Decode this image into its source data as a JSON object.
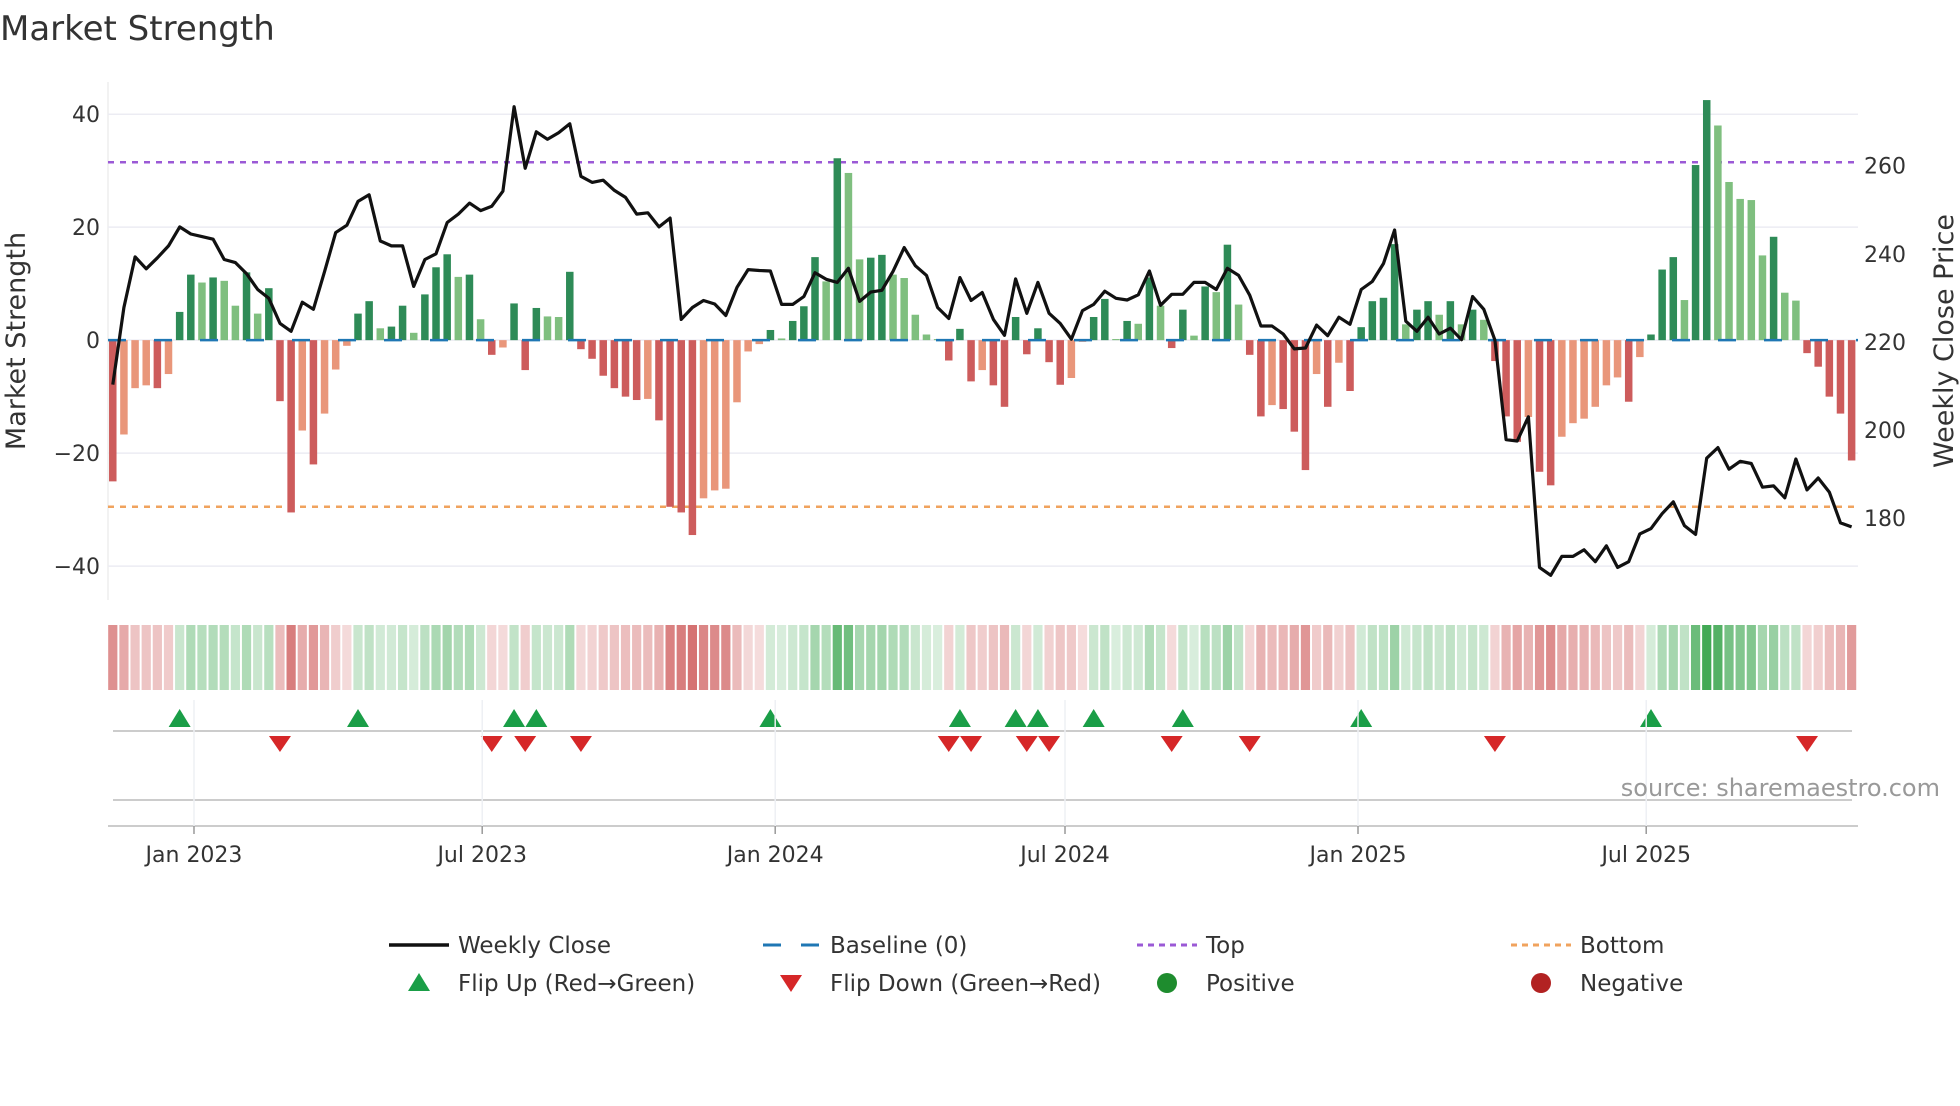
{
  "title": "Market Strength",
  "source": "source: sharemaestro.com",
  "colors": {
    "pos_strong": "#2e8b57",
    "pos_weak": "#7fbf7f",
    "neg_strong": "#cd5c5c",
    "neg_weak": "#e9967a",
    "price": "#111111",
    "baseline": "#1f77b4",
    "top": "#9b59d6",
    "bottom": "#f0a35e",
    "flip_up": "#1a9e47",
    "flip_down": "#d62728",
    "positive": "#1e8c2e",
    "negative": "#b22222"
  },
  "legend": [
    {
      "key": "price",
      "label": "Weekly Close",
      "icon": "line-solid"
    },
    {
      "key": "baseline",
      "label": "Baseline (0)",
      "icon": "line-dashed"
    },
    {
      "key": "top",
      "label": "Top",
      "icon": "line-dotted"
    },
    {
      "key": "bottom",
      "label": "Bottom",
      "icon": "line-dotted"
    },
    {
      "key": "flip_up",
      "label": "Flip Up (Red→Green)",
      "icon": "triangle-up"
    },
    {
      "key": "flip_down",
      "label": "Flip Down (Green→Red)",
      "icon": "triangle-down"
    },
    {
      "key": "positive",
      "label": "Positive",
      "icon": "circle"
    },
    {
      "key": "negative",
      "label": "Negative",
      "icon": "circle"
    }
  ],
  "chart_data": {
    "type": "bar+line",
    "title": "Market Strength",
    "ylabel": "Market Strength",
    "y2label": "Weekly Close Price",
    "x_start": "2022-11-11",
    "x_interval_days": 7,
    "xlim": [
      "2022-11-08",
      "2025-11-11"
    ],
    "xticks": [
      {
        "date": "2023-01-01",
        "label": "Jan 2023"
      },
      {
        "date": "2023-07-01",
        "label": "Jul 2023"
      },
      {
        "date": "2024-01-01",
        "label": "Jan 2024"
      },
      {
        "date": "2024-07-01",
        "label": "Jul 2024"
      },
      {
        "date": "2025-01-01",
        "label": "Jan 2025"
      },
      {
        "date": "2025-07-01",
        "label": "Jul 2025"
      }
    ],
    "ylim": [
      -46,
      45.7
    ],
    "yticks": [
      40,
      20,
      0,
      -20,
      -40
    ],
    "ytick_labels": [
      "40",
      "20",
      "0",
      "−20",
      "−40"
    ],
    "y2lim": [
      161.4,
      279
    ],
    "y2ticks": [
      260,
      240,
      220,
      200,
      180
    ],
    "y2tick_labels": [
      "260",
      "240",
      "220",
      "200",
      "180"
    ],
    "top_level": 31.5,
    "bottom_level": -29.5,
    "baseline": 0,
    "grid": true,
    "legend_position": "bottom",
    "strength": [
      -25,
      -16.7,
      -8.5,
      -8,
      -8.5,
      -6,
      5,
      11.6,
      10.2,
      11.1,
      10.5,
      6.1,
      12,
      4.7,
      9.2,
      -10.8,
      -30.5,
      -16,
      -22,
      -13,
      -5.2,
      -1,
      4.7,
      6.9,
      2.1,
      2.4,
      6.1,
      1.3,
      8.1,
      12.9,
      15.2,
      11.2,
      11.6,
      3.7,
      -2.6,
      -1.3,
      6.5,
      -5.3,
      5.7,
      4.2,
      4.1,
      12.1,
      -1.6,
      -3.3,
      -6.3,
      -8.5,
      -10,
      -10.6,
      -10.4,
      -14.2,
      -29.5,
      -30.5,
      -34.5,
      -28,
      -26.6,
      -26.3,
      -11,
      -2,
      -0.7,
      1.8,
      0.3,
      3.4,
      6,
      14.7,
      10.4,
      32.2,
      29.6,
      14.3,
      14.6,
      15.1,
      11.6,
      11,
      4.5,
      1,
      0.2,
      -3.6,
      2,
      -7.3,
      -5.3,
      -8,
      -11.8,
      4.1,
      -2.5,
      2.1,
      -3.9,
      -7.9,
      -6.7,
      -0.3,
      4.1,
      7.3,
      0.2,
      3.4,
      2.9,
      11.1,
      6.1,
      -1.4,
      5.4,
      0.8,
      9.5,
      8.5,
      16.9,
      6.3,
      -2.6,
      -13.5,
      -11.5,
      -12.2,
      -16.2,
      -23,
      -6,
      -11.8,
      -4,
      -9,
      2.3,
      6.9,
      7.5,
      17,
      2.8,
      5.4,
      6.9,
      4.5,
      6.9,
      2.8,
      5.4,
      3.6,
      -3.7,
      -13.5,
      -18,
      -13.6,
      -23.3,
      -25.7,
      -17.1,
      -14.7,
      -13.9,
      -11.8,
      -8,
      -6.6,
      -10.9,
      -3,
      1,
      12.5,
      14.7,
      7.1,
      31,
      42.5,
      38,
      28,
      25,
      24.8,
      15,
      18.3,
      8.4,
      7,
      -2.3,
      -4.7,
      -10,
      -13,
      -21.3
    ],
    "weekly_close": [
      210.3,
      227.8,
      239.3,
      236.6,
      239.1,
      241.8,
      246.1,
      244.5,
      243.9,
      243.3,
      238.7,
      238.0,
      235.5,
      231.9,
      229.9,
      224.2,
      222.4,
      229.0,
      227.4,
      236.0,
      244.8,
      246.5,
      251.9,
      253.4,
      242.9,
      241.8,
      241.8,
      232.6,
      238.7,
      240.0,
      247.1,
      249.0,
      251.5,
      249.8,
      250.8,
      254.2,
      273.4,
      259.4,
      267.7,
      266.0,
      267.5,
      269.5,
      257.6,
      256.2,
      256.7,
      254.4,
      252.8,
      249.0,
      249.3,
      246.1,
      248.1,
      225.1,
      227.8,
      229.4,
      228.6,
      226.0,
      232.4,
      236.4,
      236.2,
      236.1,
      228.5,
      228.5,
      230.3,
      235.7,
      234.2,
      233.5,
      236.7,
      229.2,
      231.3,
      231.7,
      236.0,
      241.4,
      237.3,
      235.1,
      227.8,
      225.3,
      234.6,
      229.4,
      231.2,
      225.1,
      221.5,
      234.3,
      226.5,
      233.5,
      226.5,
      224.2,
      220.6,
      227.1,
      228.5,
      231.5,
      229.9,
      229.5,
      230.7,
      236.1,
      228.3,
      230.8,
      230.8,
      233.5,
      233.5,
      231.9,
      236.7,
      235.1,
      230.6,
      223.6,
      223.6,
      221.8,
      218.4,
      218.6,
      223.8,
      221.4,
      225.6,
      224.0,
      231.9,
      233.7,
      237.8,
      245.4,
      224.7,
      222.4,
      225.6,
      221.8,
      223.1,
      220.5,
      230.3,
      227.4,
      220.4,
      197.8,
      197.5,
      203.0,
      168.8,
      167.0,
      171.3,
      171.3,
      172.8,
      170.1,
      173.7,
      168.8,
      170.1,
      176.4,
      177.6,
      181.0,
      183.7,
      178.3,
      176.3,
      193.6,
      196.0,
      191.1,
      192.9,
      192.4,
      187.0,
      187.3,
      184.6,
      193.4,
      186.4,
      189.1,
      185.9,
      178.9,
      178.0
    ]
  }
}
